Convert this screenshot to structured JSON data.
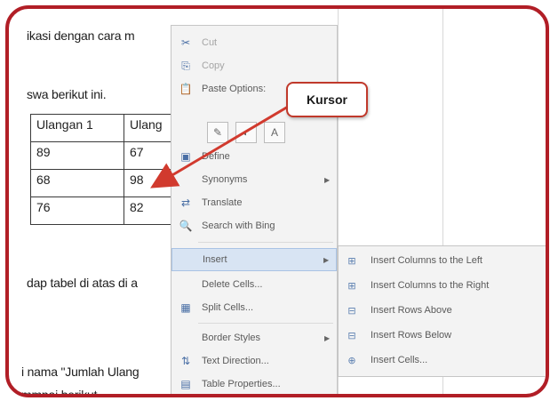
{
  "document": {
    "lines": [
      "ikasi dengan cara m",
      "swa berikut ini.",
      "dap tabel di atas di a",
      "i nama \"Jumlah Ulang",
      "mmpai berikut"
    ],
    "table": {
      "headers": [
        "Ulangan 1",
        "Ulang"
      ],
      "rows": [
        [
          "89",
          "67"
        ],
        [
          "68",
          "98"
        ],
        [
          "76",
          "82"
        ]
      ]
    }
  },
  "context_menu": {
    "items": [
      {
        "label": "Cut",
        "icon": "scissors-icon",
        "glyph": "✂"
      },
      {
        "label": "Copy",
        "icon": "copy-icon",
        "glyph": "⎘"
      },
      {
        "label": "Paste Options:",
        "icon": "paste-icon",
        "glyph": "📋"
      },
      {
        "label": "Define",
        "icon": "define-icon",
        "glyph": "▣"
      },
      {
        "label": "Synonyms",
        "icon": "synonyms-icon",
        "glyph": ""
      },
      {
        "label": "Translate",
        "icon": "translate-icon",
        "glyph": "⇄"
      },
      {
        "label": "Search with Bing",
        "icon": "search-icon",
        "glyph": "🔍"
      },
      {
        "label": "Insert",
        "icon": "insert-icon",
        "glyph": ""
      },
      {
        "label": "Delete Cells...",
        "icon": "delete-cells-icon",
        "glyph": ""
      },
      {
        "label": "Split Cells...",
        "icon": "split-cells-icon",
        "glyph": "▦"
      },
      {
        "label": "Border Styles",
        "icon": "border-styles-icon",
        "glyph": ""
      },
      {
        "label": "Text Direction...",
        "icon": "text-direction-icon",
        "glyph": "⇅"
      },
      {
        "label": "Table Properties...",
        "icon": "table-properties-icon",
        "glyph": "▤"
      }
    ],
    "paste_icons": [
      "keep-formatting-icon",
      "merge-formatting-icon",
      "keep-text-only-icon"
    ]
  },
  "submenu": {
    "items": [
      {
        "label": "Insert Columns to the Left",
        "icon": "insert-columns-left-icon",
        "glyph": "⊞"
      },
      {
        "label": "Insert Columns to the Right",
        "icon": "insert-columns-right-icon",
        "glyph": "⊞"
      },
      {
        "label": "Insert Rows Above",
        "icon": "insert-rows-above-icon",
        "glyph": "⊟"
      },
      {
        "label": "Insert Rows Below",
        "icon": "insert-rows-below-icon",
        "glyph": "⊟"
      },
      {
        "label": "Insert Cells...",
        "icon": "insert-cells-icon",
        "glyph": "⊕"
      }
    ]
  },
  "callout": {
    "label": "Kursor"
  },
  "colors": {
    "frame": "#b11e26",
    "callout_border": "#c0392b",
    "arrow": "#d13a2e",
    "highlight": "#d8e4f3"
  }
}
